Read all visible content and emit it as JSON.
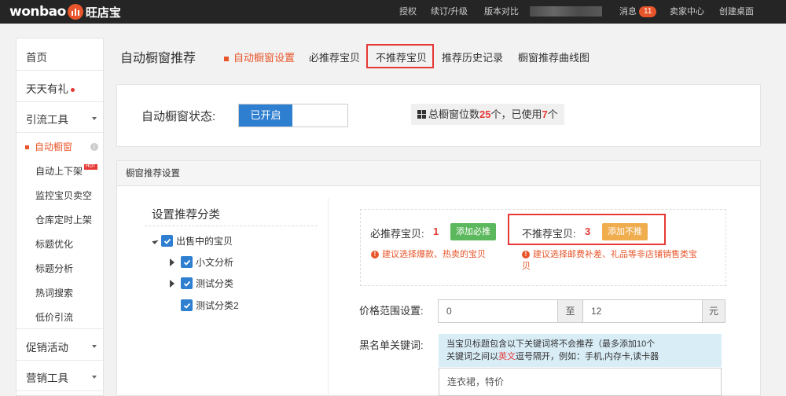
{
  "logo": {
    "brand": "wonbao",
    "cn": "旺店宝"
  },
  "topnav": {
    "auth": "授权",
    "renew": "续订/升级",
    "compare": "版本对比",
    "message": "消息",
    "message_count": "11",
    "seller_center": "卖家中心",
    "create_desktop": "创建桌面"
  },
  "sidebar": {
    "home": "首页",
    "daily_gift": "天天有礼",
    "traffic_tools": "引流工具",
    "sub_items": [
      "自动橱窗",
      "自动上下架",
      "监控宝贝卖空",
      "仓库定时上架",
      "标题优化",
      "标题分析",
      "热词搜索",
      "低价引流"
    ],
    "hot_badge": "HOT",
    "promo": "促销活动",
    "marketing": "营销工具"
  },
  "header": {
    "title": "自动橱窗推荐",
    "tabs": [
      "自动橱窗设置",
      "必推荐宝贝",
      "不推荐宝贝",
      "推荐历史记录",
      "橱窗推荐曲线图"
    ]
  },
  "status": {
    "label": "自动橱窗状态:",
    "toggle_on": "已开启",
    "total_prefix": "总橱窗位数",
    "total": "25",
    "mid": "个，已使用",
    "used": "7",
    "suffix": "个"
  },
  "settings": {
    "panel_title": "橱窗推荐设置",
    "category_title": "设置推荐分类",
    "tree": {
      "root": "出售中的宝贝",
      "children": [
        "小文分析",
        "测试分类",
        "测试分类2"
      ]
    },
    "must_label": "必推荐宝贝:",
    "must_count": "1",
    "must_btn": "添加必推",
    "must_tip": "建议选择爆款、热卖的宝贝",
    "no_label": "不推荐宝贝:",
    "no_count": "3",
    "no_btn": "添加不推",
    "no_tip_1": "建议选择邮费补差、礼品等非店铺销售类宝",
    "no_tip_2": "贝",
    "price_label": "价格范围设置:",
    "price_min": "0",
    "price_to": "至",
    "price_max": "12",
    "price_unit": "元",
    "blacklist_label": "黑名单关键词:",
    "blacklist_note_1": "当宝贝标题包含以下关键词将不会推荐（最多添加10个",
    "blacklist_note_2a": "关键词之间以",
    "blacklist_note_2b": "英文",
    "blacklist_note_2c": "逗号隔开，例如：手机,内存卡,读卡器",
    "blacklist_value": "连衣裙，特价"
  },
  "colors": {
    "accent": "#e8552a",
    "primary": "#2f7fd1",
    "highlight": "#e53935",
    "green": "#5cb85c",
    "orange": "#f0ad4e"
  }
}
